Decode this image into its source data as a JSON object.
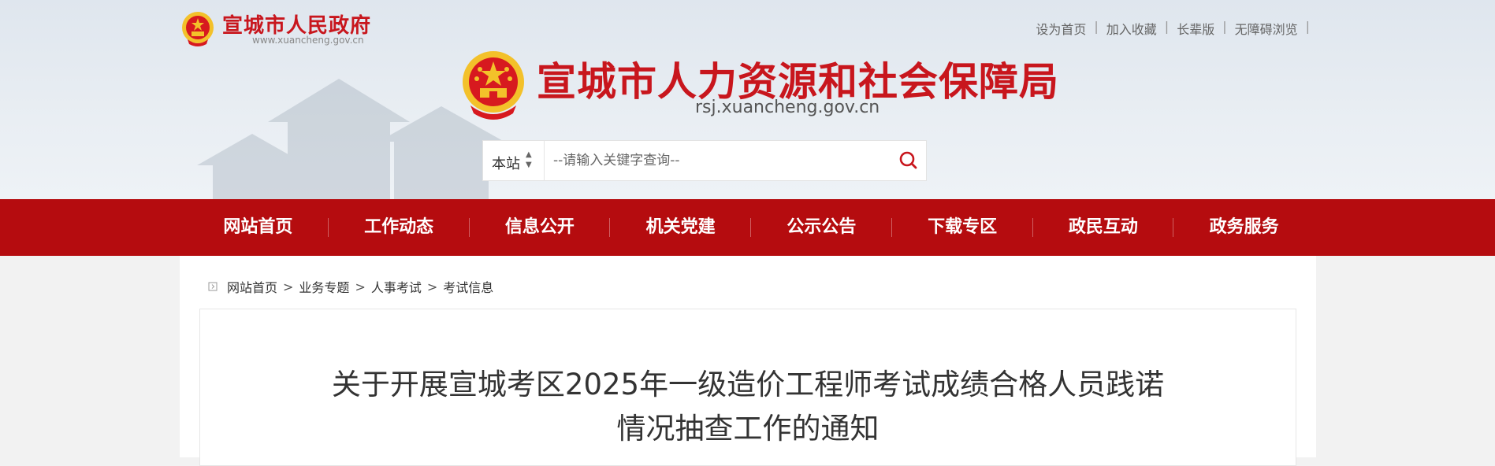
{
  "gov_brand": {
    "name": "宣城市人民政府",
    "url": "www.xuancheng.gov.cn"
  },
  "top_links": [
    "设为首页",
    "加入收藏",
    "长辈版",
    "无障碍浏览"
  ],
  "site_brand": {
    "name": "宣城市人力资源和社会保障局",
    "url": "rsj.xuancheng.gov.cn"
  },
  "search": {
    "scope_label": "本站",
    "placeholder": "--请输入关键字查询--",
    "value": ""
  },
  "nav": {
    "items": [
      {
        "label": "网站首页"
      },
      {
        "label": "工作动态"
      },
      {
        "label": "信息公开"
      },
      {
        "label": "机关党建"
      },
      {
        "label": "公示公告"
      },
      {
        "label": "下载专区"
      },
      {
        "label": "政民互动"
      },
      {
        "label": "政务服务"
      }
    ]
  },
  "breadcrumb": {
    "items": [
      "网站首页",
      "业务专题",
      "人事考试",
      "考试信息"
    ],
    "separator": ">"
  },
  "article": {
    "title_line1": "关于开展宣城考区2025年一级造价工程师考试成绩合格人员践诺",
    "title_line2": "情况抽查工作的通知"
  },
  "colors": {
    "brand_red": "#c8161d",
    "nav_red": "#b50c0f",
    "emblem_gold": "#f3c12a"
  },
  "icons": [
    "national-emblem-icon",
    "chevron-up-down-icon",
    "search-icon",
    "breadcrumb-icon"
  ]
}
